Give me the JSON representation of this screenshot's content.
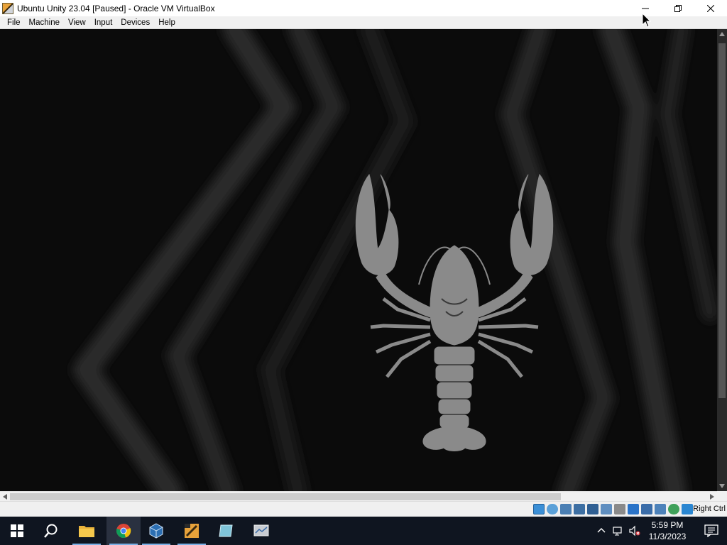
{
  "window": {
    "title": "Ubuntu Unity 23.04 [Paused] - Oracle VM VirtualBox"
  },
  "menu": {
    "items": [
      "File",
      "Machine",
      "View",
      "Input",
      "Devices",
      "Help"
    ]
  },
  "status_bar": {
    "host_key": "Right Ctrl",
    "icons": [
      "hard-disk-icon",
      "optical-drive-icon",
      "audio-icon",
      "network-icon",
      "usb-icon",
      "shared-folders-icon",
      "display-icon",
      "recording-icon",
      "vt-x-icon",
      "guest-additions-icon",
      "mouse-integration-icon",
      "keyboard-icon"
    ]
  },
  "taskbar": {
    "apps": [
      "start-icon",
      "search-icon",
      "file-explorer-icon",
      "chrome-icon",
      "virtualbox-icon",
      "virtualbox-vm-icon",
      "app-icon-blue",
      "app-icon-gray"
    ],
    "clock_time": "5:59 PM",
    "clock_date": "11/3/2023"
  },
  "colors": {
    "taskbar_bg": "#0f1520",
    "wallpaper_bg": "#0b0b0b",
    "lobster": "#8a8a8a"
  }
}
